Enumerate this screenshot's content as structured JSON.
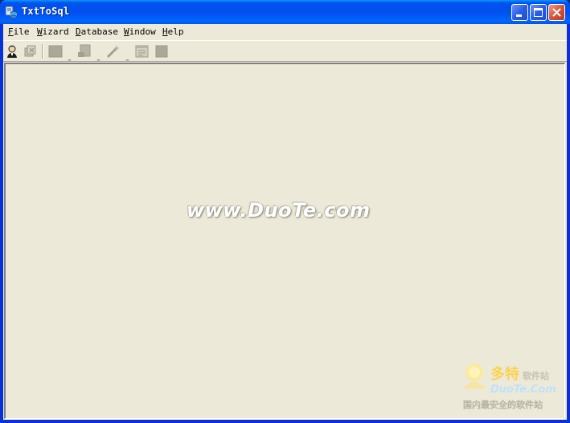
{
  "window": {
    "title": "TxtToSql"
  },
  "menubar": {
    "items": [
      "File",
      "Wizard",
      "Database",
      "Window",
      "Help"
    ]
  },
  "toolbar": {
    "buttons": [
      {
        "icon": "user-connect-icon",
        "enabled": true
      },
      {
        "icon": "disconnect-icon",
        "enabled": false
      },
      {
        "icon": "table-icon",
        "enabled": false,
        "dropdown": true
      },
      {
        "icon": "import-icon",
        "enabled": false,
        "dropdown": true
      },
      {
        "icon": "wand-icon",
        "enabled": false,
        "dropdown": true
      },
      {
        "icon": "window-icon",
        "enabled": false
      },
      {
        "icon": "stop-icon",
        "enabled": false
      }
    ]
  },
  "workspace": {
    "watermark": "www.DuoTe.com",
    "corner_logo": {
      "brand_cn": "多特",
      "tag_cn": "软件站",
      "brand_en": "DuoTe.Com",
      "slogan_cn": "国内最安全的软件站"
    }
  },
  "colors": {
    "titlebar": "#0054e3",
    "face": "#ece9d8",
    "close_button": "#d9533a"
  }
}
